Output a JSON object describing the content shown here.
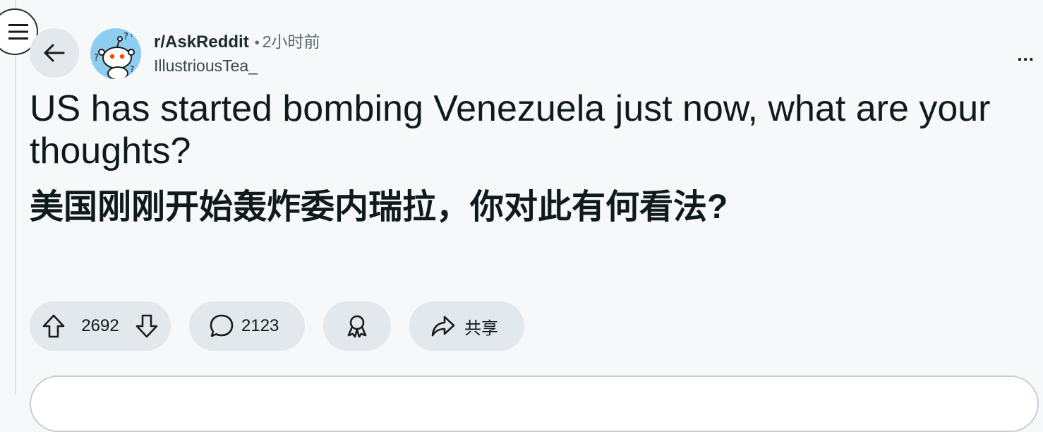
{
  "post": {
    "subreddit": "r/AskReddit",
    "separator": "•",
    "time": "2小时前",
    "author": "IllustriousTea_",
    "more": "...",
    "title": "US has started bombing Venezuela just now, what are your thoughts?",
    "body": "美国刚刚开始轰炸委内瑞拉，你对此有何看法?"
  },
  "actions": {
    "votes": "2692",
    "comments": "2123",
    "share_label": "共享"
  },
  "icons": {
    "menu": "hamburger-menu-icon",
    "back": "back-arrow-icon",
    "upvote": "upvote-arrow-icon",
    "downvote": "downvote-arrow-icon",
    "comment": "comment-bubble-icon",
    "award": "award-ribbon-icon",
    "share": "share-arrow-icon"
  },
  "colors": {
    "page_bg": "#f6f8fa",
    "pill_bg": "#e3e8ec",
    "text": "#0f1a1c",
    "avatar_bg": "#8fcdf0",
    "snoo_accent": "#ff4500"
  }
}
